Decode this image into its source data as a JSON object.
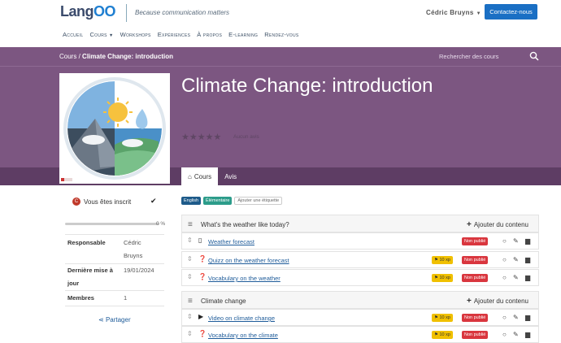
{
  "header": {
    "logo_text": "Lang",
    "logo_suffix": "OO",
    "tagline": "Because communication matters",
    "user_name": "Cédric Bruyns",
    "contact_button": "Contactez-nous"
  },
  "nav": [
    {
      "label": "Accueil"
    },
    {
      "label": "Cours",
      "dropdown": true
    },
    {
      "label": "Workshops"
    },
    {
      "label": "Expériences"
    },
    {
      "label": "À propos"
    },
    {
      "label": "E-learning"
    },
    {
      "label": "Rendez-vous"
    }
  ],
  "breadcrumb": {
    "root": "Cours",
    "separator": "/",
    "current": "Climate Change: introduction"
  },
  "search": {
    "placeholder": "Rechercher des cours"
  },
  "course": {
    "title": "Climate Change: introduction",
    "rating_stars": 0,
    "rating_max": 5,
    "rating_text": "Aucun avis",
    "tabs": [
      {
        "label": "Cours",
        "icon": "home-icon"
      },
      {
        "label": "Avis"
      }
    ]
  },
  "sidebar": {
    "enrolled_text": "Vous êtes inscrit",
    "progress_fraction": 0,
    "progress_label": "0 %",
    "meta": [
      {
        "label": "Responsable",
        "value": "Cédric Bruyns"
      },
      {
        "label": "Dernière mise à jour",
        "value": "19/01/2024"
      },
      {
        "label": "Membres",
        "value": "1"
      }
    ],
    "share_label": "Partager"
  },
  "tags": [
    "English",
    "Élémentaire",
    "Ajouter une étiquette"
  ],
  "sections": [
    {
      "title": "What's the weather like today?",
      "add_label": "Ajouter du contenu",
      "items": [
        {
          "label": "Weather forecast",
          "icon": "file-pdf-icon",
          "xp": null,
          "status": "Non publié"
        },
        {
          "label": "Quizz on the weather forecast",
          "icon": "question-icon",
          "xp": "10 xp",
          "status": "Non publié"
        },
        {
          "label": "Vocabulary on the weather",
          "icon": "question-icon",
          "xp": "10 xp",
          "status": "Non publié"
        }
      ]
    },
    {
      "title": "Climate change",
      "add_label": "Ajouter du contenu",
      "items": [
        {
          "label": "Video on climate change",
          "icon": "video-icon",
          "xp": "10 xp",
          "status": "Non publié"
        },
        {
          "label": "Vocabulary on the climate",
          "icon": "question-icon",
          "xp": "10 xp",
          "status": "Non publié"
        }
      ]
    }
  ],
  "colors": {
    "hero": "#7c5681",
    "hero_dark": "#5e3d64",
    "primary": "#1a6fc4",
    "xp": "#f0c000",
    "unpublished": "#d9363e"
  }
}
